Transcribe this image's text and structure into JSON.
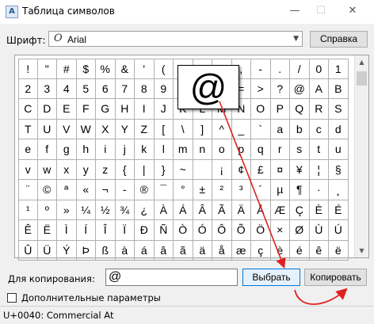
{
  "window": {
    "title": "Таблица символов",
    "minimize": "—",
    "maximize": "☐",
    "close": "✕"
  },
  "font_picker": {
    "label": "Шрифт:",
    "value": "Arial",
    "icon": "opentype-font-icon",
    "icon_glyph": "O"
  },
  "help_button": "Справка",
  "characters": [
    [
      "!",
      "\"",
      "#",
      "$",
      "%",
      "&",
      "'",
      "(",
      ")",
      "*",
      "+",
      ",",
      "-",
      ".",
      "/",
      "0",
      "1"
    ],
    [
      "2",
      "3",
      "4",
      "5",
      "6",
      "7",
      "8",
      "9",
      ":",
      ";",
      "<",
      "=",
      ">",
      "?",
      "@",
      "A",
      "B"
    ],
    [
      "C",
      "D",
      "E",
      "F",
      "G",
      "H",
      "I",
      "J",
      "K",
      "L",
      "M",
      "N",
      "O",
      "P",
      "Q",
      "R",
      "S"
    ],
    [
      "T",
      "U",
      "V",
      "W",
      "X",
      "Y",
      "Z",
      "[",
      "\\",
      "]",
      "^",
      "_",
      "`",
      "a",
      "b",
      "c",
      "d"
    ],
    [
      "e",
      "f",
      "g",
      "h",
      "i",
      "j",
      "k",
      "l",
      "m",
      "n",
      "o",
      "p",
      "q",
      "r",
      "s",
      "t",
      "u"
    ],
    [
      "v",
      "w",
      "x",
      "y",
      "z",
      "{",
      "|",
      "}",
      "~",
      " ",
      "¡",
      "¢",
      "£",
      "¤",
      "¥",
      "¦",
      "§"
    ],
    [
      "¨",
      "©",
      "ª",
      "«",
      "¬",
      "-",
      "®",
      "¯",
      "°",
      "±",
      "²",
      "³",
      "´",
      "µ",
      "¶",
      "·",
      "¸"
    ],
    [
      "¹",
      "º",
      "»",
      "¼",
      "½",
      "¾",
      "¿",
      "À",
      "Á",
      "Â",
      "Ã",
      "Ä",
      "Å",
      "Æ",
      "Ç",
      "È",
      "É"
    ],
    [
      "Ê",
      "Ë",
      "Ì",
      "Í",
      "Î",
      "Ï",
      "Ð",
      "Ñ",
      "Ò",
      "Ó",
      "Ô",
      "Õ",
      "Ö",
      "×",
      "Ø",
      "Ù",
      "Ú"
    ],
    [
      "Û",
      "Ü",
      "Ý",
      "Þ",
      "ß",
      "à",
      "á",
      "â",
      "ã",
      "ä",
      "å",
      "æ",
      "ç",
      "è",
      "é",
      "ê",
      "ë"
    ]
  ],
  "zoomed_character": "@",
  "copy_section": {
    "label": "Для копирования:",
    "value": "@",
    "select_button": "Выбрать",
    "copy_button": "Копировать"
  },
  "advanced_options": {
    "label": "Дополнительные параметры",
    "checked": false
  },
  "status": "U+0040: Commercial At",
  "scrollbar": {
    "up": "▲",
    "down": "▼"
  },
  "annotation_color": "#e02020"
}
